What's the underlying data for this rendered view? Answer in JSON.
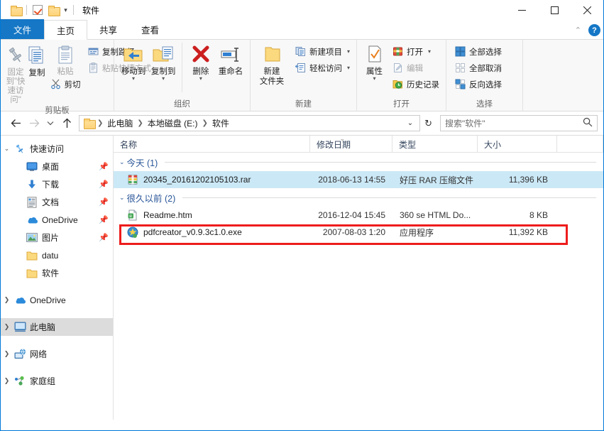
{
  "window": {
    "title": "软件",
    "quick_access": [
      "folder-icon",
      "checkbox-icon",
      "folder-icon"
    ],
    "controls": {
      "minimize": "–",
      "maximize": "□",
      "close": "✕"
    }
  },
  "tabs": [
    {
      "label": "文件",
      "kind": "file"
    },
    {
      "label": "主页",
      "kind": "active"
    },
    {
      "label": "共享",
      "kind": "normal"
    },
    {
      "label": "查看",
      "kind": "normal"
    }
  ],
  "ribbon": {
    "collapse_icon": "chevron-up-icon",
    "help_icon": "help-icon",
    "help_label": "?",
    "groups": [
      {
        "name": "clipboard",
        "label": "剪贴板",
        "big_buttons": [
          {
            "label": "固定到\"快速访问\"",
            "icon": "pin-icon",
            "disabled": true
          },
          {
            "label": "复制",
            "icon": "copy-icon",
            "disabled": false
          },
          {
            "label": "粘贴",
            "icon": "paste-icon",
            "disabled": true
          }
        ],
        "sub_buttons": [
          {
            "label": "剪切",
            "icon": "scissors-icon",
            "disabled": false
          }
        ],
        "small_buttons": [
          {
            "label": "复制路径",
            "icon": "copy-path-icon",
            "disabled": false
          },
          {
            "label": "粘贴快捷方式",
            "icon": "paste-shortcut-icon",
            "disabled": true
          }
        ]
      },
      {
        "name": "organize",
        "label": "组织",
        "big_buttons": [
          {
            "label": "移动到",
            "icon": "move-to-icon",
            "has_caret": true
          },
          {
            "label": "复制到",
            "icon": "copy-to-icon",
            "has_caret": true
          },
          {
            "label": "删除",
            "icon": "delete-icon",
            "has_caret": true
          },
          {
            "label": "重命名",
            "icon": "rename-icon",
            "has_caret": false
          }
        ]
      },
      {
        "name": "new",
        "label": "新建",
        "big_buttons": [
          {
            "label": "新建\n文件夹",
            "label_line1": "新建",
            "label_line2": "文件夹",
            "icon": "new-folder-icon"
          }
        ],
        "small_buttons": [
          {
            "label": "新建项目",
            "icon": "new-item-icon",
            "has_caret": true
          },
          {
            "label": "轻松访问",
            "icon": "easy-access-icon",
            "has_caret": true
          }
        ]
      },
      {
        "name": "open",
        "label": "打开",
        "big_buttons": [
          {
            "label": "属性",
            "icon": "properties-icon",
            "has_caret": true
          }
        ],
        "small_buttons": [
          {
            "label": "打开",
            "icon": "open-icon",
            "has_caret": true,
            "disabled": false
          },
          {
            "label": "编辑",
            "icon": "edit-icon",
            "disabled": true
          },
          {
            "label": "历史记录",
            "icon": "history-icon",
            "disabled": false
          }
        ]
      },
      {
        "name": "select",
        "label": "选择",
        "small_buttons": [
          {
            "label": "全部选择",
            "icon": "select-all-icon"
          },
          {
            "label": "全部取消",
            "icon": "select-none-icon"
          },
          {
            "label": "反向选择",
            "icon": "invert-selection-icon"
          }
        ]
      }
    ]
  },
  "addressbar": {
    "back_icon": "back-arrow-icon",
    "forward_icon": "forward-arrow-icon",
    "recent_icon": "chevron-down-icon",
    "up_icon": "up-arrow-icon",
    "breadcrumb": [
      "此电脑",
      "本地磁盘 (E:)",
      "软件"
    ],
    "breadcrumb_dropdown": "⌄",
    "refresh_icon": "refresh-icon",
    "search": {
      "placeholder": "搜索\"软件\"",
      "value": "",
      "icon": "search-icon"
    }
  },
  "navpane": {
    "items": [
      {
        "label": "快速访问",
        "icon": "quick-access-pin-icon",
        "expander": "expanded",
        "level": 0,
        "pinned": false,
        "selected": false
      },
      {
        "label": "桌面",
        "icon": "desktop-icon",
        "expander": "none",
        "level": 1,
        "pinned": true,
        "selected": false
      },
      {
        "label": "下载",
        "icon": "downloads-icon",
        "expander": "none",
        "level": 1,
        "pinned": true,
        "selected": false
      },
      {
        "label": "文档",
        "icon": "documents-icon",
        "expander": "none",
        "level": 1,
        "pinned": true,
        "selected": false
      },
      {
        "label": "OneDrive",
        "icon": "onedrive-cloud-icon",
        "expander": "none",
        "level": 1,
        "pinned": true,
        "selected": false
      },
      {
        "label": "图片",
        "icon": "pictures-icon",
        "expander": "none",
        "level": 1,
        "pinned": true,
        "selected": false
      },
      {
        "label": "datu",
        "icon": "folder-icon",
        "expander": "none",
        "level": 1,
        "pinned": false,
        "selected": false
      },
      {
        "label": "软件",
        "icon": "folder-icon",
        "expander": "none",
        "level": 1,
        "pinned": false,
        "selected": false
      },
      {
        "label": "OneDrive",
        "icon": "onedrive-cloud-icon",
        "expander": "collapsed",
        "level": 0,
        "pinned": false,
        "selected": false
      },
      {
        "label": "此电脑",
        "icon": "this-pc-icon",
        "expander": "collapsed",
        "level": 0,
        "pinned": false,
        "selected": true
      },
      {
        "label": "网络",
        "icon": "network-icon",
        "expander": "collapsed",
        "level": 0,
        "pinned": false,
        "selected": false
      },
      {
        "label": "家庭组",
        "icon": "homegroup-icon",
        "expander": "collapsed",
        "level": 0,
        "pinned": false,
        "selected": false
      }
    ]
  },
  "filelist": {
    "columns": [
      {
        "label": "名称",
        "key": "name"
      },
      {
        "label": "修改日期",
        "key": "date",
        "sorted": true,
        "sort_dir": "asc"
      },
      {
        "label": "类型",
        "key": "type"
      },
      {
        "label": "大小",
        "key": "size"
      }
    ],
    "groups": [
      {
        "header": "今天 (1)",
        "caret": "expanded",
        "rows": [
          {
            "name": "20345_20161202105103.rar",
            "date": "2018-06-13 14:55",
            "type": "好压 RAR 压缩文件",
            "size": "11,396 KB",
            "icon": "rar-archive-icon",
            "selected": true,
            "annotated": false
          }
        ]
      },
      {
        "header": "很久以前 (2)",
        "caret": "expanded",
        "rows": [
          {
            "name": "Readme.htm",
            "date": "2016-12-04 15:45",
            "type": "360 se HTML Do...",
            "size": "8 KB",
            "icon": "html-document-icon",
            "selected": false,
            "annotated": false
          },
          {
            "name": "pdfcreator_v0.9.3c1.0.exe",
            "date": "2007-08-03 1:20",
            "type": "应用程序",
            "size": "11,392 KB",
            "icon": "application-exe-icon",
            "selected": false,
            "annotated": true
          }
        ]
      }
    ]
  },
  "annotation": {
    "color": "#ee1c1c",
    "shape": "rectangle",
    "target": "pdfcreator_v0.9.3c1.0.exe"
  },
  "colors": {
    "accent": "#1577c6",
    "selection": "#cbe8f6",
    "nav_selection": "#dcdcdc",
    "group_header_text": "#2a5699",
    "annotation_red": "#ee1c1c"
  }
}
